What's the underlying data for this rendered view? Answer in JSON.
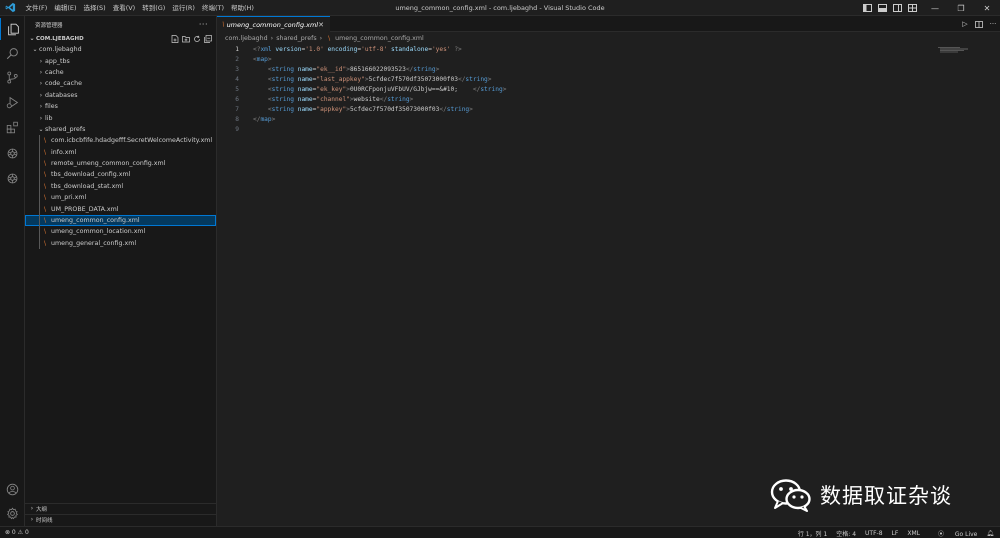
{
  "titlebar": {
    "menus": [
      "文件(F)",
      "编辑(E)",
      "选择(S)",
      "查看(V)",
      "转到(G)",
      "运行(R)",
      "终端(T)",
      "帮助(H)"
    ],
    "window_title": "umeng_common_config.xml - com.ljebaghd - Visual Studio Code"
  },
  "activitybar": {
    "icons": [
      "explorer-icon",
      "search-icon",
      "source-control-icon",
      "run-debug-icon",
      "extensions-icon",
      "openai-icon",
      "openai-icon",
      "account-icon",
      "settings-gear-icon"
    ]
  },
  "sidebar": {
    "title": "资源管理器",
    "more": "···",
    "root": "COM.LJEBAGHD",
    "folder": "com.ljebaghd",
    "dirs": [
      "app_tbs",
      "cache",
      "code_cache",
      "databases",
      "files",
      "lib"
    ],
    "open_dir": "shared_prefs",
    "files": [
      "com.icbcbfife.hdadgefff.SecretWelcomeActivity.xml",
      "info.xml",
      "remote_umeng_common_config.xml",
      "tbs_download_config.xml",
      "tbs_download_stat.xml",
      "um_pri.xml",
      "UM_PROBE_DATA.xml",
      "umeng_common_config.xml",
      "umeng_common_location.xml",
      "umeng_general_config.xml"
    ],
    "selected_file": "umeng_common_config.xml",
    "outline": "大纲",
    "timeline": "时间线"
  },
  "editor": {
    "tab_label": "umeng_common_config.xml",
    "breadcrumb": [
      "com.ljebaghd",
      "shared_prefs",
      "umeng_common_config.xml"
    ],
    "line_numbers": [
      "1",
      "2",
      "3",
      "4",
      "5",
      "6",
      "7",
      "8",
      "9"
    ],
    "xml_decl": {
      "version": "1.0",
      "encoding": "utf-8",
      "standalone": "yes"
    },
    "root_tag": "map",
    "entries": [
      {
        "name": "ek__id",
        "value": "865166022093523"
      },
      {
        "name": "last_appkey",
        "value": "5cfdec7f570df35073000f03"
      },
      {
        "name": "ek_key",
        "value": "0U0RCFponjuVFbUV/GJbjw==&#10;    "
      },
      {
        "name": "channel",
        "value": "website"
      },
      {
        "name": "appkey",
        "value": "5cfdec7f570df35073000f03"
      }
    ]
  },
  "statusbar": {
    "problems": "⊗ 0 ⚠ 0",
    "position": "行 1，列 1",
    "spaces": "空格: 4",
    "encoding": "UTF-8",
    "eol": "LF",
    "language": "XML",
    "go_live": "Go Live"
  },
  "watermark": {
    "text": "数据取证杂谈"
  },
  "colors": {
    "accent": "#0078d4",
    "selection": "#04395e",
    "xml_file_icon": "#e37933"
  }
}
